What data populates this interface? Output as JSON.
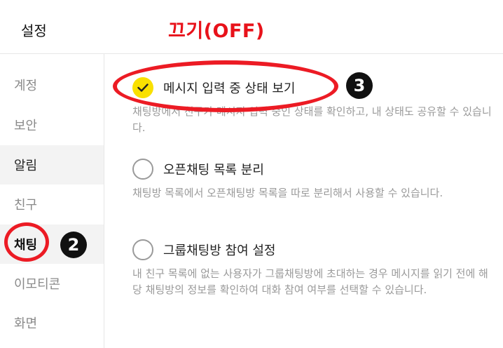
{
  "header": {
    "title": "설정",
    "annotation": "끄기(OFF)"
  },
  "sidebar": {
    "items": [
      {
        "label": "계정"
      },
      {
        "label": "보안"
      },
      {
        "label": "알림"
      },
      {
        "label": "친구"
      },
      {
        "label": "채팅"
      },
      {
        "label": "이모티콘"
      },
      {
        "label": "화면"
      }
    ]
  },
  "options": [
    {
      "label": "메시지 입력 중 상태 보기",
      "checked": true,
      "description": "채팅방에서 친구가 메시지 입력 중인 상태를 확인하고, 내 상태도 공유할 수 있습니다."
    },
    {
      "label": "오픈채팅 목록 분리",
      "checked": false,
      "description": "채팅방 목록에서 오픈채팅방 목록을 따로 분리해서 사용할 수 있습니다."
    },
    {
      "label": "그룹채팅방 참여 설정",
      "checked": false,
      "description": "내 친구 목록에 없는 사용자가 그룹채팅방에 초대하는 경우 메시지를 읽기 전에 해당 채팅방의 정보를 확인하여 대화 참여 여부를 선택할 수 있습니다."
    }
  ],
  "annotations": {
    "badge_sidebar": "2",
    "badge_option": "3",
    "ring_color": "#ec1b24"
  },
  "colors": {
    "accent_check": "#f9e000",
    "annotation_red": "#e8121a"
  }
}
